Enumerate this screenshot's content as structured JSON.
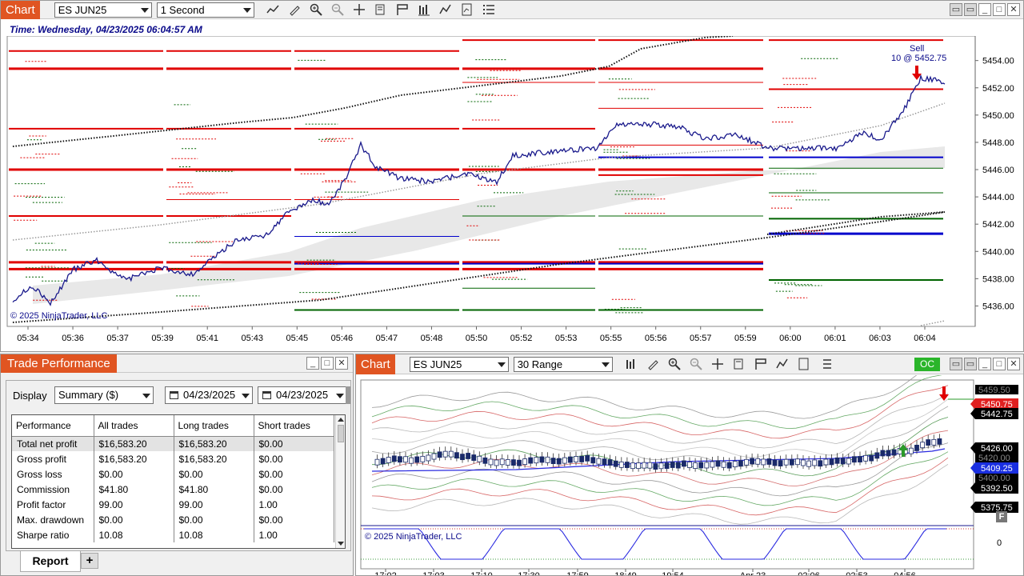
{
  "top_chart": {
    "title": "Chart",
    "instrument": "ES JUN25",
    "interval": "1 Second",
    "time_label": "Time: Wednesday, 04/23/2025 06:04:57 AM",
    "copyright": "© 2025 NinjaTrader, LLC",
    "sell_label": "Sell",
    "sell_detail": "10 @ 5452.75",
    "price_ticks": [
      "5454.00",
      "5452.00",
      "5450.00",
      "5448.00",
      "5446.00",
      "5444.00",
      "5442.00",
      "5440.00",
      "5438.00",
      "5436.00"
    ],
    "time_ticks": [
      "05:34",
      "05:36",
      "05:37",
      "05:39",
      "05:41",
      "05:43",
      "05:45",
      "05:46",
      "05:47",
      "05:48",
      "05:50",
      "05:52",
      "05:53",
      "05:55",
      "05:56",
      "05:57",
      "05:59",
      "06:00",
      "06:01",
      "06:03",
      "06:04"
    ],
    "price_range": [
      5434.5,
      5455.8
    ],
    "line_color": "#1a1a8c",
    "red_level_color": "#e00000",
    "green_level_color": "#006400",
    "blue_level_color": "#0000cc"
  },
  "trade_performance": {
    "title": "Trade Performance",
    "display_label": "Display",
    "display_value": "Summary ($)",
    "date_from": "04/23/2025",
    "date_to": "04/23/2025",
    "headers": [
      "Performance",
      "All trades",
      "Long trades",
      "Short trades"
    ],
    "rows": [
      [
        "Total net profit",
        "$16,583.20",
        "$16,583.20",
        "$0.00"
      ],
      [
        "Gross profit",
        "$16,583.20",
        "$16,583.20",
        "$0.00"
      ],
      [
        "Gross loss",
        "$0.00",
        "$0.00",
        "$0.00"
      ],
      [
        "Commission",
        "$41.80",
        "$41.80",
        "$0.00"
      ],
      [
        "Profit factor",
        "99.00",
        "99.00",
        "1.00"
      ],
      [
        "Max. drawdown",
        "$0.00",
        "$0.00",
        "$0.00"
      ],
      [
        "Sharpe ratio",
        "10.08",
        "10.08",
        "1.00"
      ]
    ],
    "tab_report": "Report",
    "tab_add": "+"
  },
  "bottom_chart": {
    "title": "Chart",
    "instrument": "ES JUN25",
    "interval": "30 Range",
    "oc_label": "OC",
    "copyright": "© 2025 NinjaTrader, LLC",
    "price_labels": [
      {
        "text": "5450.75",
        "color": "#e02020"
      },
      {
        "text": "5442.75",
        "color": "#000000"
      },
      {
        "text": "5426.00",
        "color": "#000000"
      },
      {
        "text": "5409.25",
        "color": "#1a2fe0"
      },
      {
        "text": "5392.50",
        "color": "#000000"
      },
      {
        "text": "5375.75",
        "color": "#000000"
      }
    ],
    "faint_labels": [
      "5459.50",
      "5420.00",
      "5400.00"
    ],
    "osc_zero": "0",
    "f_button": "F",
    "time_ticks": [
      "17:02",
      "17:03",
      "17:10",
      "17:30",
      "17:59",
      "18:49",
      "19:54",
      "Apr 23",
      "02:06",
      "02:53",
      "04:56"
    ]
  }
}
